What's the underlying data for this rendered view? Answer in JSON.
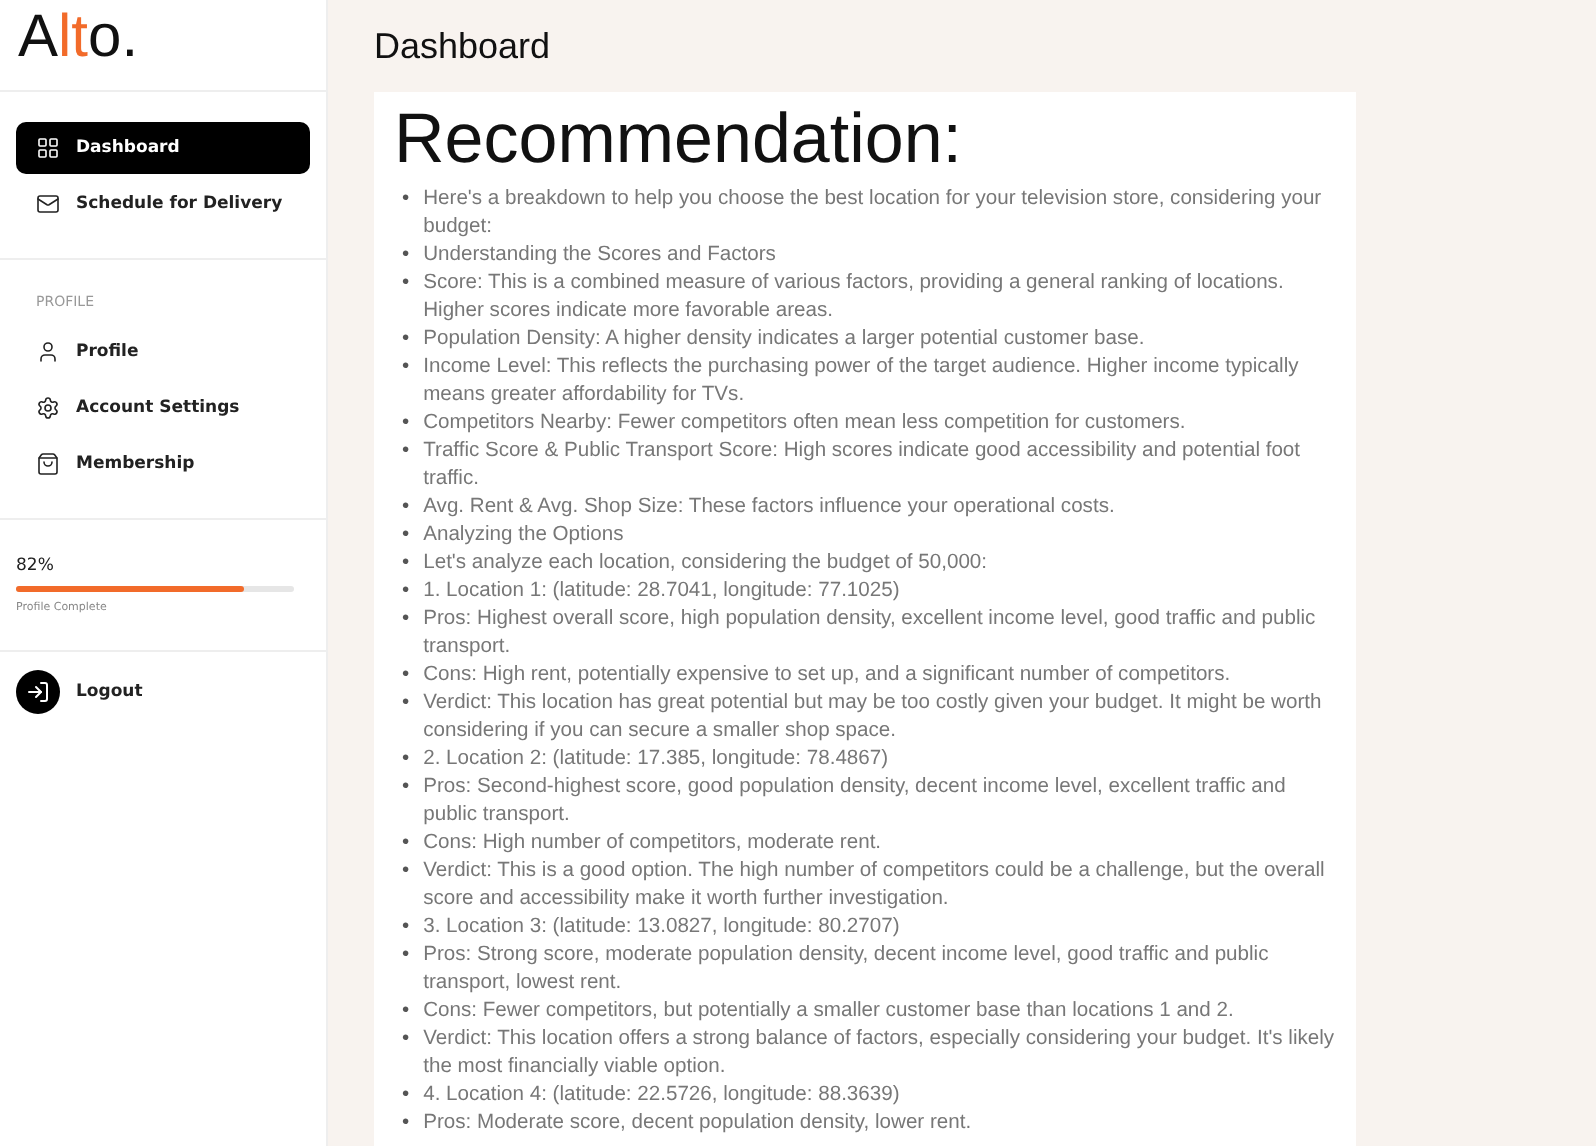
{
  "logo": {
    "parts": [
      "A",
      "lt",
      "o."
    ]
  },
  "nav": [
    {
      "label": "Dashboard",
      "selected": true
    },
    {
      "label": "Schedule for Delivery",
      "selected": false
    }
  ],
  "profile_section": {
    "heading": "PROFILE",
    "items": [
      {
        "label": "Profile",
        "selected": false
      },
      {
        "label": "Account Settings",
        "selected": false
      },
      {
        "label": "Membership",
        "selected": false
      }
    ]
  },
  "progress": {
    "percent": "82%",
    "level": 0.82,
    "caption": "Profile Complete"
  },
  "logout": {
    "label": "Logout"
  },
  "page_title": "Dashboard",
  "card": {
    "title": "Recommendation:",
    "bullet": "•",
    "items": [
      "Here's a breakdown to help you choose the best location for your television store, considering your budget:",
      "Understanding the Scores and Factors",
      "Score: This is a combined measure of various factors, providing a general ranking of locations. Higher scores indicate more favorable areas.",
      "Population Density: A higher density indicates a larger potential customer base.",
      "Income Level: This reflects the purchasing power of the target audience. Higher income typically means greater affordability for TVs.",
      "Competitors Nearby: Fewer competitors often mean less competition for customers.",
      "Traffic Score & Public Transport Score: High scores indicate good accessibility and potential foot traffic.",
      "Avg. Rent & Avg. Shop Size: These factors influence your operational costs.",
      "Analyzing the Options",
      "Let's analyze each location, considering the budget of 50,000:",
      "1. Location 1: (latitude: 28.7041, longitude: 77.1025)",
      "Pros: Highest overall score, high population density, excellent income level, good traffic and public transport.",
      "Cons: High rent, potentially expensive to set up, and a significant number of competitors.",
      "Verdict: This location has great potential but may be too costly given your budget. It might be worth considering if you can secure a smaller shop space.",
      "2. Location 2: (latitude: 17.385, longitude: 78.4867)",
      "Pros: Second-highest score, good population density, decent income level, excellent traffic and public transport.",
      "Cons: High number of competitors, moderate rent.",
      "Verdict: This is a good option. The high number of competitors could be a challenge, but the overall score and accessibility make it worth further investigation.",
      "3. Location 3: (latitude: 13.0827, longitude: 80.2707)",
      "Pros: Strong score, moderate population density, decent income level, good traffic and public transport, lowest rent.",
      "Cons: Fewer competitors, but potentially a smaller customer base than locations 1 and 2.",
      "Verdict: This location offers a strong balance of factors, especially considering your budget. It's likely the most financially viable option.",
      "4. Location 4: (latitude: 22.5726, longitude: 88.3639)",
      "Pros: Moderate score, decent population density, lower rent."
    ]
  }
}
